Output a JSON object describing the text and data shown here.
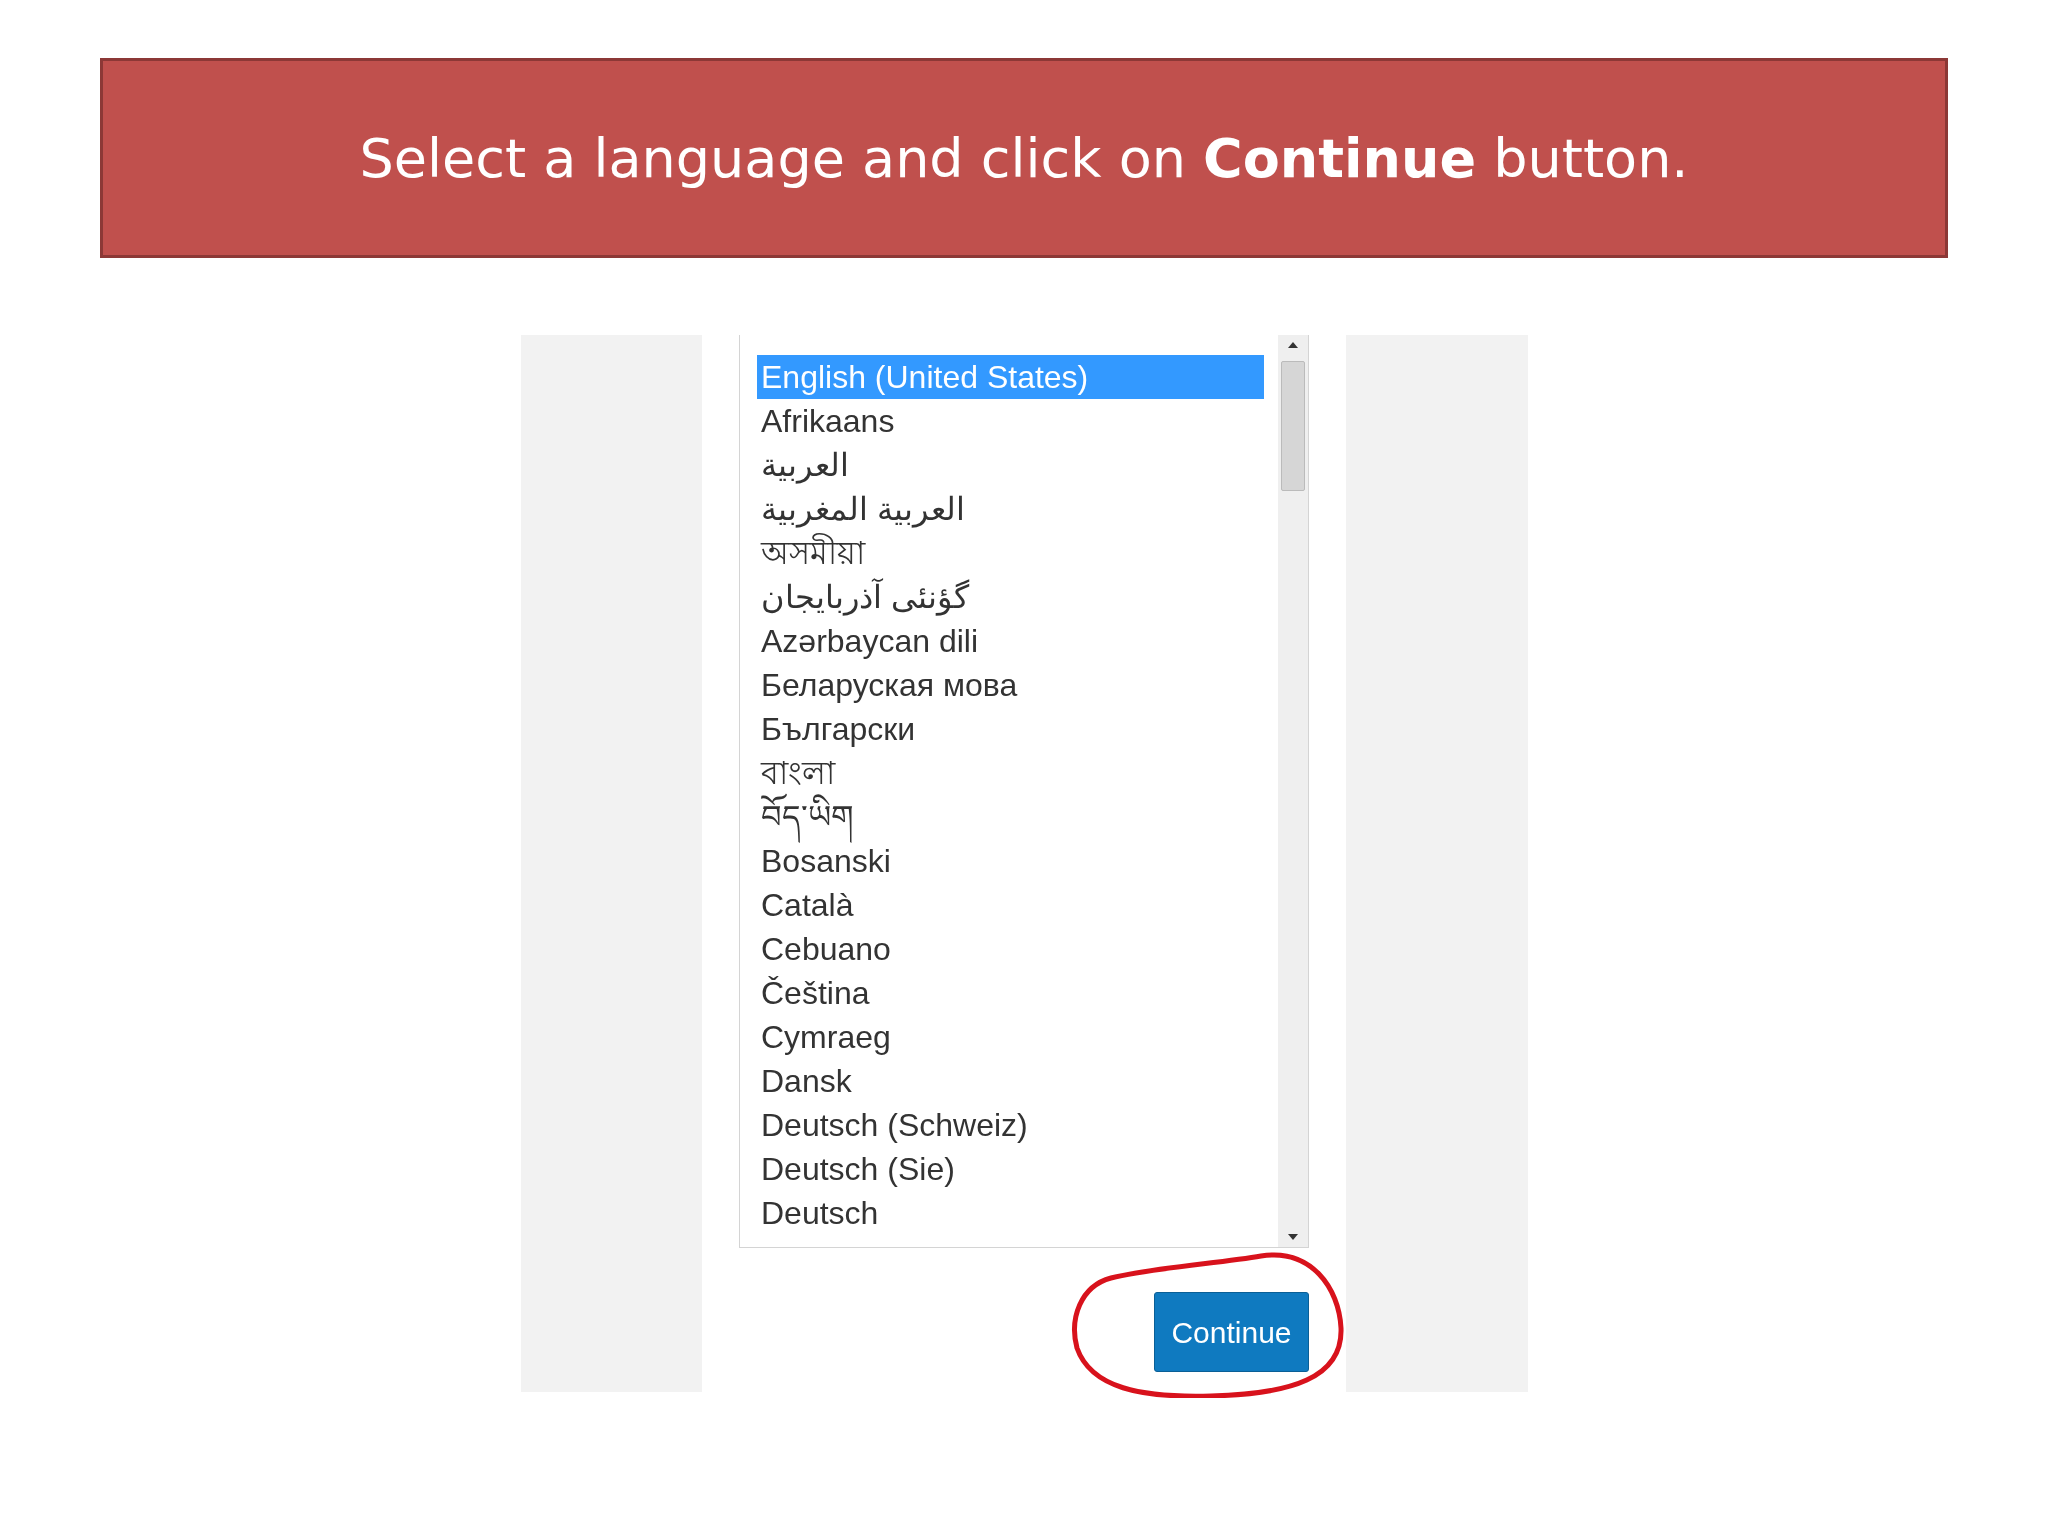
{
  "banner": {
    "text": "Select a language and click on **Continue** button."
  },
  "language_list": {
    "items": [
      {
        "label": "English (United States)",
        "selected": true
      },
      {
        "label": "Afrikaans",
        "selected": false
      },
      {
        "label": "العربية",
        "selected": false
      },
      {
        "label": "العربية المغربية",
        "selected": false
      },
      {
        "label": "অসমীয়া",
        "selected": false
      },
      {
        "label": "گؤنئی آذربایجان",
        "selected": false
      },
      {
        "label": "Azərbaycan dili",
        "selected": false
      },
      {
        "label": "Беларуская мова",
        "selected": false
      },
      {
        "label": "Български",
        "selected": false
      },
      {
        "label": "বাংলা",
        "selected": false
      },
      {
        "label": "བོད་ཡིག",
        "selected": false
      },
      {
        "label": "Bosanski",
        "selected": false
      },
      {
        "label": "Català",
        "selected": false
      },
      {
        "label": "Cebuano",
        "selected": false
      },
      {
        "label": "Čeština",
        "selected": false
      },
      {
        "label": "Cymraeg",
        "selected": false
      },
      {
        "label": "Dansk",
        "selected": false
      },
      {
        "label": "Deutsch (Schweiz)",
        "selected": false
      },
      {
        "label": "Deutsch (Sie)",
        "selected": false
      },
      {
        "label": "Deutsch",
        "selected": false
      }
    ]
  },
  "continue_button": {
    "label": "Continue"
  }
}
